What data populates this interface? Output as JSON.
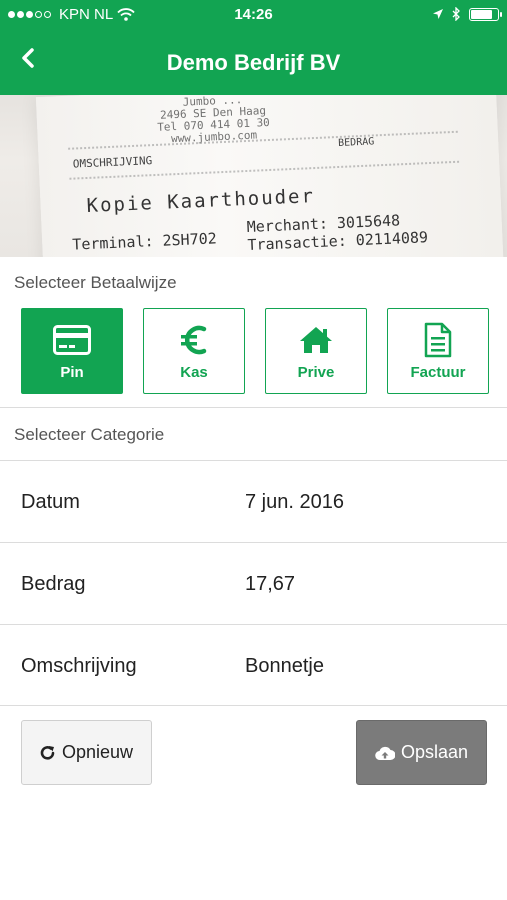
{
  "status": {
    "carrier": "KPN NL",
    "time": "14:26",
    "battery_level": 0.85
  },
  "header": {
    "title": "Demo Bedrijf BV",
    "back_icon": "chevron-left-icon"
  },
  "receipt_photo": {
    "line1": "Jumbo ...",
    "line2": "2496 SE Den Haag",
    "line3": "Tel 070 414 01 30",
    "line4": "www.jumbo.com",
    "col_desc": "OMSCHRIJVING",
    "col_amount": "BEDRAG",
    "copy": "Kopie Kaarthouder",
    "terminal": "Terminal: 2SH702",
    "merchant": "Merchant: 3015648",
    "trans": "Transactie: 02114089"
  },
  "payment": {
    "label": "Selecteer Betaalwijze",
    "options": [
      {
        "label": "Pin",
        "icon": "credit-card-icon",
        "selected": true
      },
      {
        "label": "Kas",
        "icon": "euro-icon",
        "selected": false
      },
      {
        "label": "Prive",
        "icon": "home-icon",
        "selected": false
      },
      {
        "label": "Factuur",
        "icon": "document-icon",
        "selected": false
      }
    ]
  },
  "category": {
    "label": "Selecteer Categorie"
  },
  "fields": [
    {
      "key": "Datum",
      "value": "7 jun. 2016"
    },
    {
      "key": "Bedrag",
      "value": "17,67"
    },
    {
      "key": "Omschrijving",
      "value": "Bonnetje"
    }
  ],
  "actions": {
    "reset_label": "Opnieuw",
    "reset_icon": "refresh-icon",
    "save_label": "Opslaan",
    "save_icon": "cloud-upload-icon"
  },
  "colors": {
    "brand": "#12a452",
    "save_disabled": "#7b7b7b"
  }
}
